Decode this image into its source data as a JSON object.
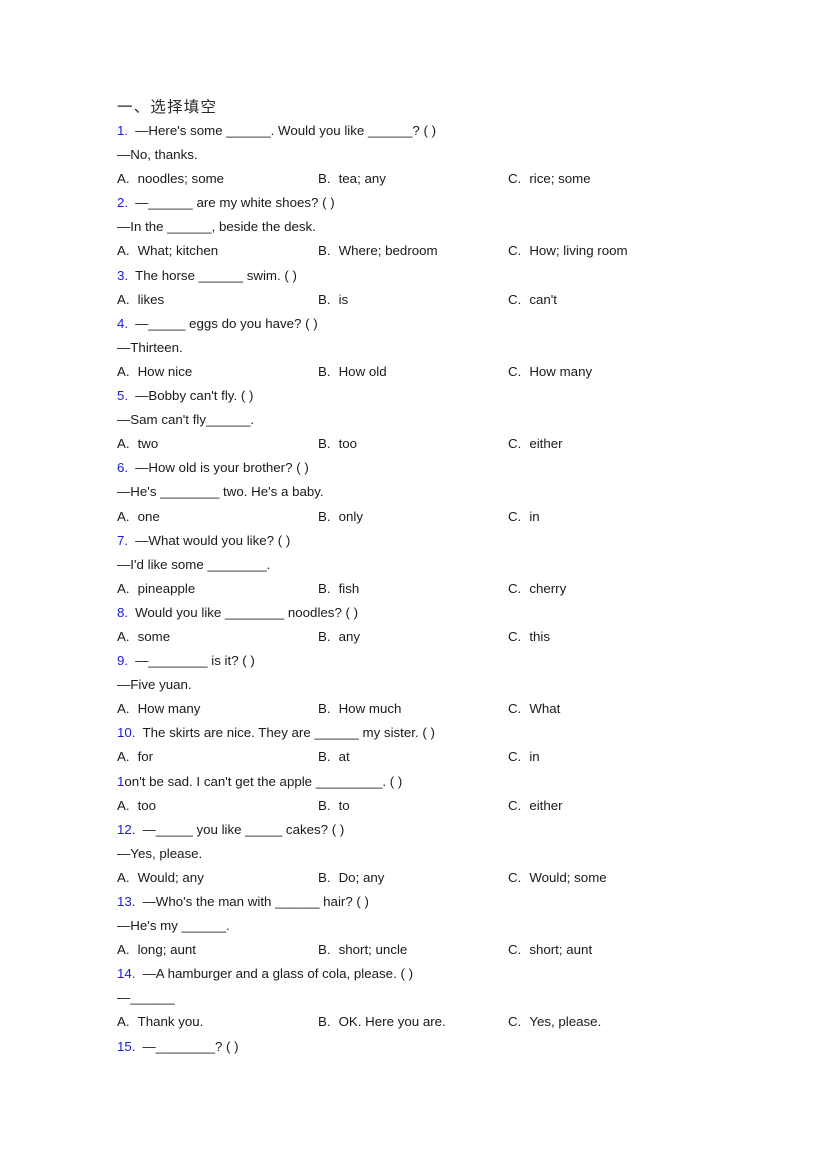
{
  "document": {
    "heading": "一、选择填空",
    "accent_color": "#1a1ae0",
    "text_color": "#1a1a1a",
    "background_color": "#ffffff"
  },
  "questions": [
    {
      "number": "1.",
      "stem": "—Here's some ______. Would you like ______? (    )",
      "reply": "—No, thanks.",
      "options": [
        {
          "letter": "A.",
          "text": "noodles; some"
        },
        {
          "letter": "B.",
          "text": "tea; any"
        },
        {
          "letter": "C.",
          "text": "rice; some"
        }
      ]
    },
    {
      "number": "2.",
      "stem": "—______ are my white shoes? (    )",
      "reply": "—In the ______, beside the desk.",
      "options": [
        {
          "letter": "A.",
          "text": "What; kitchen"
        },
        {
          "letter": "B.",
          "text": "Where; bedroom"
        },
        {
          "letter": "C.",
          "text": "How; living room"
        }
      ]
    },
    {
      "number": "3.",
      "stem": "The horse ______ swim. (  )",
      "reply": "",
      "options": [
        {
          "letter": "A.",
          "text": "likes"
        },
        {
          "letter": "B.",
          "text": "is"
        },
        {
          "letter": "C.",
          "text": "can't"
        }
      ]
    },
    {
      "number": "4.",
      "stem": "—_____ eggs do you have? (  )",
      "reply": "—Thirteen.",
      "options": [
        {
          "letter": "A.",
          "text": "How nice"
        },
        {
          "letter": "B.",
          "text": "How old"
        },
        {
          "letter": "C.",
          "text": "How many"
        }
      ]
    },
    {
      "number": "5.",
      "stem": "—Bobby can't fly. (  )",
      "reply": "—Sam can't fly______.",
      "options": [
        {
          "letter": "A.",
          "text": "two"
        },
        {
          "letter": "B.",
          "text": "too"
        },
        {
          "letter": "C.",
          "text": "either"
        }
      ]
    },
    {
      "number": "6.",
      "stem": "—How old is your brother? (  )",
      "reply": "—He's ________ two. He's a baby.",
      "options": [
        {
          "letter": "A.",
          "text": "one"
        },
        {
          "letter": "B.",
          "text": "only"
        },
        {
          "letter": "C.",
          "text": "in"
        }
      ]
    },
    {
      "number": "7.",
      "stem": "—What would you like? (  )",
      "reply": "—I'd like some ________.",
      "options": [
        {
          "letter": "A.",
          "text": "pineapple"
        },
        {
          "letter": "B.",
          "text": "fish"
        },
        {
          "letter": "C.",
          "text": "cherry"
        }
      ]
    },
    {
      "number": "8.",
      "stem": "Would you like ________ noodles? (  )",
      "reply": "",
      "options": [
        {
          "letter": "A.",
          "text": "some"
        },
        {
          "letter": "B.",
          "text": "any"
        },
        {
          "letter": "C.",
          "text": "this"
        }
      ]
    },
    {
      "number": "9.",
      "stem": "—________ is it? (  )",
      "reply": "—Five yuan.",
      "options": [
        {
          "letter": "A.",
          "text": "How many"
        },
        {
          "letter": "B.",
          "text": "How much"
        },
        {
          "letter": "C.",
          "text": "What"
        }
      ]
    },
    {
      "number": "10.",
      "stem": "The skirts are nice. They are ______ my sister. (   )",
      "reply": "",
      "options": [
        {
          "letter": "A.",
          "text": "for"
        },
        {
          "letter": "B.",
          "text": "at"
        },
        {
          "letter": "C.",
          "text": "in"
        }
      ]
    },
    {
      "number": "1",
      "number_inline": true,
      "stem": "on't be sad. I can't get the apple _________. (   )",
      "reply": "",
      "options": [
        {
          "letter": "A.",
          "text": "too"
        },
        {
          "letter": "B.",
          "text": "to"
        },
        {
          "letter": "C.",
          "text": "either"
        }
      ]
    },
    {
      "number": "12.",
      "stem": "—_____ you like _____ cakes? (   )",
      "reply": "—Yes, please.",
      "options": [
        {
          "letter": "A.",
          "text": "Would; any"
        },
        {
          "letter": "B.",
          "text": "Do; any"
        },
        {
          "letter": "C.",
          "text": "Would; some"
        }
      ]
    },
    {
      "number": "13.",
      "stem": "—Who's the man with ______ hair? (   )",
      "reply": "—He's my ______.",
      "options": [
        {
          "letter": "A.",
          "text": "long; aunt"
        },
        {
          "letter": "B.",
          "text": "short; uncle"
        },
        {
          "letter": "C.",
          "text": "short; aunt"
        }
      ]
    },
    {
      "number": "14.",
      "stem": "—A hamburger and a glass of cola, please. (   )",
      "reply": "—______",
      "options": [
        {
          "letter": "A.",
          "text": "Thank you."
        },
        {
          "letter": "B.",
          "text": "OK. Here you are."
        },
        {
          "letter": "C.",
          "text": "Yes, please."
        }
      ]
    },
    {
      "number": "15.",
      "stem": "—________? (   )",
      "reply": "",
      "options": []
    }
  ]
}
